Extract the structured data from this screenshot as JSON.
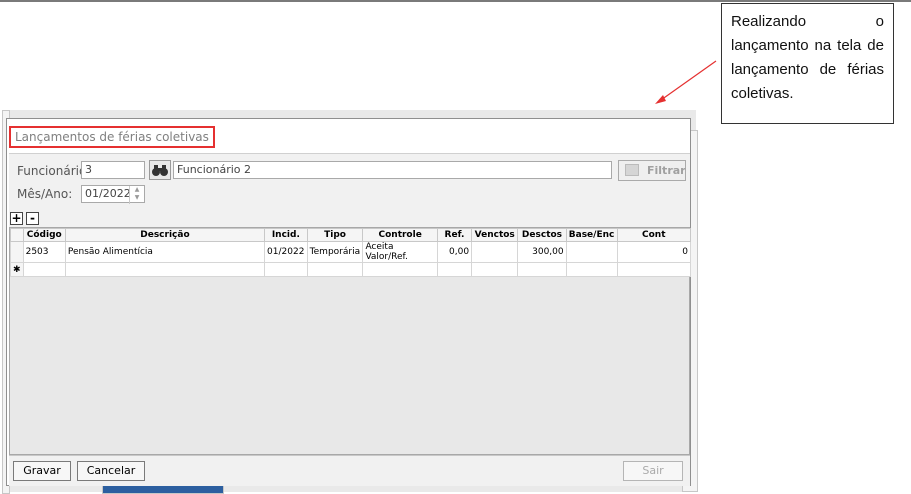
{
  "callout": {
    "text": "Realizando o lançamento na tela de lançamento de férias coletivas."
  },
  "dialog": {
    "title": "Lançamentos de férias coletivas",
    "funcionario_label": "Funcionário:",
    "funcionario_code": "3",
    "funcionario_name": "Funcionário 2",
    "mes_ano_label": "Mês/Ano:",
    "mes_ano_value": "01/2022",
    "filter_label": "Filtrar",
    "add_label": "+",
    "remove_label": "-",
    "columns": [
      "Código",
      "Descrição",
      "Incid.",
      "Tipo",
      "Controle",
      "Ref.",
      "Venctos",
      "Desctos",
      "Base/Enc",
      "Cont"
    ],
    "rows": [
      [
        "2503",
        "Pensão Alimentícia",
        "01/2022",
        "Temporária",
        "Aceita Valor/Ref.",
        "0,00",
        "",
        "300,00",
        "",
        "0"
      ]
    ],
    "new_row_marker": "✱",
    "save_label": "Gravar",
    "cancel_label": "Cancelar",
    "exit_label": "Sair"
  },
  "colors": {
    "highlight": "#e53030",
    "arrow": "#e53030"
  },
  "icons": [
    "binoculars-icon",
    "filter-icon",
    "spin-up-icon",
    "spin-down-icon",
    "new-row-icon",
    "arrow-annotation"
  ]
}
